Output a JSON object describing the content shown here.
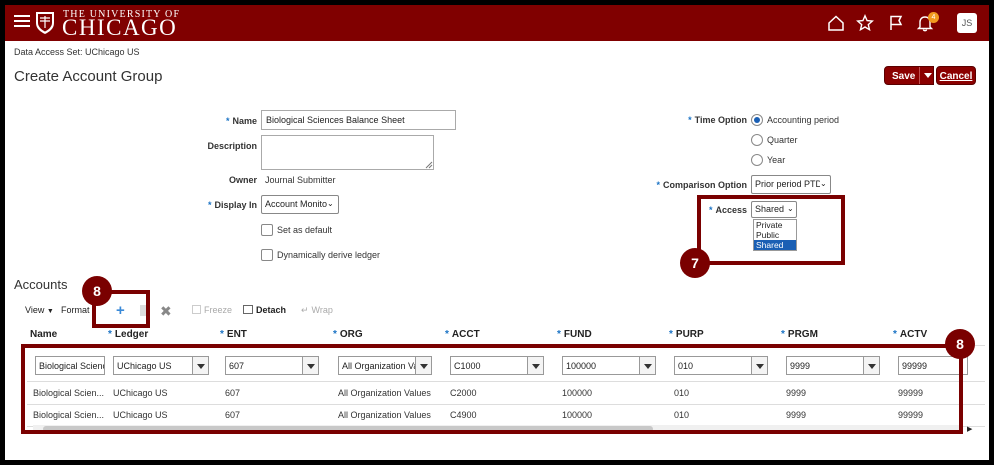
{
  "header": {
    "logo_small": "THE UNIVERSITY OF",
    "logo_big": "CHICAGO",
    "notification_count": "4",
    "user_initials": "JS",
    "brand_color": "#800000"
  },
  "page": {
    "data_access": "Data Access Set:  UChicago US",
    "title": "Create Account Group",
    "save_label": "Save",
    "cancel_label": "Cancel"
  },
  "form": {
    "name_label": "Name",
    "name_value": "Biological Sciences Balance Sheet",
    "description_label": "Description",
    "description_value": "",
    "owner_label": "Owner",
    "owner_value": "Journal Submitter",
    "display_in_label": "Display In",
    "display_in_value": "Account Monitor",
    "set_default_label": "Set as default",
    "derive_ledger_label": "Dynamically derive ledger",
    "time_option_label": "Time Option",
    "time_options": [
      "Accounting period",
      "Quarter",
      "Year"
    ],
    "time_option_selected": "Accounting period",
    "comparison_label": "Comparison Option",
    "comparison_value": "Prior period PTD",
    "access_label": "Access",
    "access_value": "Shared",
    "access_options": [
      "Private",
      "Public",
      "Shared"
    ]
  },
  "callouts": {
    "access_step": "7",
    "add_step": "8",
    "grid_step": "8"
  },
  "accounts": {
    "title": "Accounts",
    "toolbar": {
      "view": "View",
      "format": "Format",
      "freeze": "Freeze",
      "detach": "Detach",
      "wrap": "Wrap"
    },
    "columns": [
      "Name",
      "Ledger",
      "ENT",
      "ORG",
      "ACCT",
      "FUND",
      "PURP",
      "PRGM",
      "ACTV"
    ],
    "edit_row": [
      "Biological Scienc",
      "UChicago US",
      "607",
      "All Organization Va",
      "C1000",
      "100000",
      "010",
      "9999",
      "99999"
    ],
    "rows": [
      [
        "Biological Scien...",
        "UChicago US",
        "607",
        "All Organization Values",
        "C2000",
        "100000",
        "010",
        "9999",
        "99999"
      ],
      [
        "Biological Scien...",
        "UChicago US",
        "607",
        "All Organization Values",
        "C4900",
        "100000",
        "010",
        "9999",
        "99999"
      ]
    ]
  }
}
